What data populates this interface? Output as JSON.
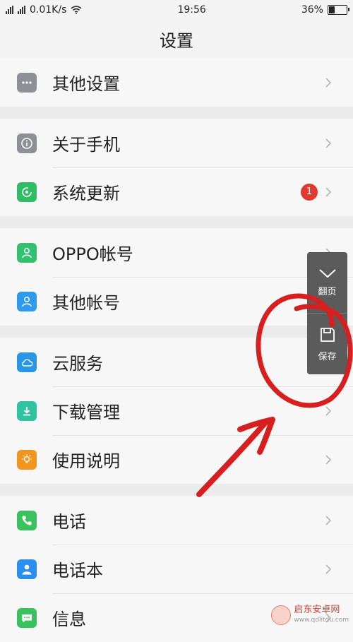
{
  "status_bar": {
    "left_small": "2G 4G",
    "speed": "0.01K/s",
    "time": "19:56",
    "battery_percent": "36%",
    "battery_level": 0.36
  },
  "header": {
    "title": "设置"
  },
  "groups": [
    {
      "items": [
        {
          "label": "其他设置",
          "icon": "more-icon",
          "color": "#8e9095"
        }
      ]
    },
    {
      "items": [
        {
          "label": "关于手机",
          "icon": "info-icon",
          "color": "#8e9095"
        },
        {
          "label": "系统更新",
          "icon": "update-icon",
          "color": "#2fbd65",
          "badge": "1"
        }
      ]
    },
    {
      "items": [
        {
          "label": "OPPO帐号",
          "icon": "person-icon",
          "color": "#33c071"
        },
        {
          "label": "其他帐号",
          "icon": "person-icon",
          "color": "#2d9cf0"
        }
      ]
    },
    {
      "items": [
        {
          "label": "云服务",
          "icon": "cloud-icon",
          "color": "#2996e8"
        },
        {
          "label": "下载管理",
          "icon": "download-icon",
          "color": "#2fc3a0"
        },
        {
          "label": "使用说明",
          "icon": "bulb-icon",
          "color": "#f2951f"
        }
      ]
    },
    {
      "items": [
        {
          "label": "电话",
          "icon": "phone-icon",
          "color": "#39c25e"
        },
        {
          "label": "电话本",
          "icon": "contacts-icon",
          "color": "#2a8ff0"
        },
        {
          "label": "信息",
          "icon": "message-icon",
          "color": "#38c15d"
        }
      ]
    }
  ],
  "floating_panel": {
    "page_turn_label": "翻页",
    "save_label": "保存"
  },
  "watermark": {
    "name": "启东安卓网",
    "url": "www.qdlitdu.com"
  }
}
